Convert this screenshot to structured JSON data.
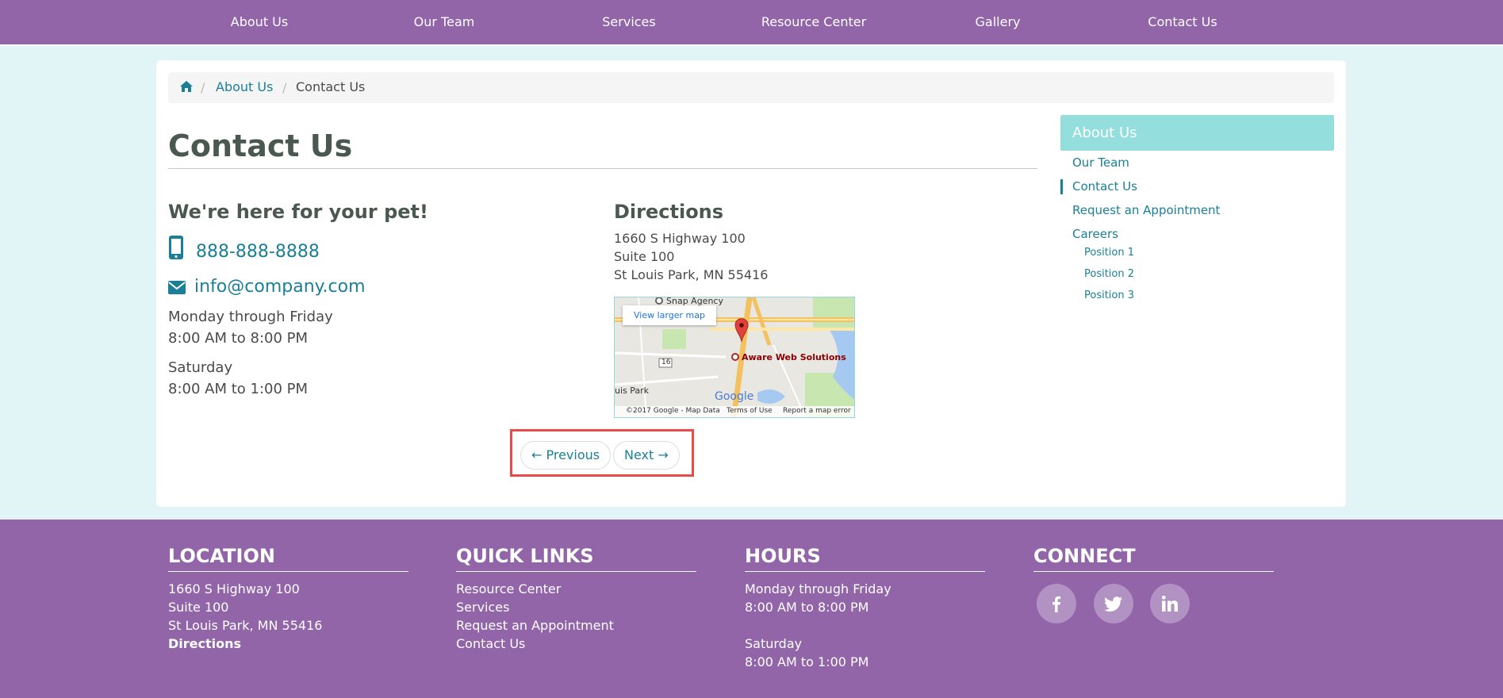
{
  "nav": {
    "items": [
      {
        "label": "About Us"
      },
      {
        "label": "Our Team"
      },
      {
        "label": "Services"
      },
      {
        "label": "Resource Center"
      },
      {
        "label": "Gallery"
      },
      {
        "label": "Contact Us"
      }
    ]
  },
  "breadcrumb": {
    "home_icon": "home-icon",
    "separator": "/",
    "items": [
      {
        "label": "About Us"
      },
      {
        "label": "Contact Us"
      }
    ]
  },
  "page": {
    "title": "Contact Us",
    "tagline": "We're here for your pet!",
    "phone": "888-888-8888",
    "email": "info@company.com",
    "hours": [
      "Monday through Friday",
      "8:00 AM to 8:00 PM",
      "Saturday",
      "8:00 AM to 1:00 PM"
    ]
  },
  "directions": {
    "title": "Directions",
    "address": [
      "1660 S Highway 100",
      "Suite 100",
      "St Louis Park, MN 55416"
    ]
  },
  "map": {
    "view_larger": "View larger map",
    "marker_label": "Aware Web Solutions",
    "places": [
      "Snap Agency",
      "uis Park",
      "16"
    ],
    "logo": "Google",
    "footer": [
      "©2017 Google - Map Data",
      "Terms of Use",
      "Report a map error"
    ]
  },
  "pager": {
    "previous": "← Previous",
    "next": "Next →"
  },
  "sidebar": {
    "header": "About Us",
    "items": [
      {
        "label": "Our Team"
      },
      {
        "label": "Contact Us"
      },
      {
        "label": "Request an Appointment"
      },
      {
        "label": "Careers"
      }
    ],
    "sub_items": [
      {
        "label": "Position 1"
      },
      {
        "label": "Position 2"
      },
      {
        "label": "Position 3"
      }
    ]
  },
  "footer": {
    "location": {
      "heading": "LOCATION",
      "lines": [
        "1660 S Highway 100",
        "Suite 100",
        "St Louis Park, MN 55416"
      ],
      "link": "Directions"
    },
    "quick_links": {
      "heading": "QUICK LINKS",
      "links": [
        "Resource Center",
        "Services",
        "Request an Appointment",
        "Contact Us"
      ]
    },
    "hours": {
      "heading": "HOURS",
      "lines": [
        "Monday through Friday",
        "8:00 AM to 8:00 PM",
        "Saturday",
        "8:00 AM to 1:00 PM"
      ]
    },
    "connect": {
      "heading": "CONNECT",
      "icons": [
        "facebook-icon",
        "twitter-icon",
        "linkedin-icon"
      ]
    }
  },
  "colors": {
    "brand_purple": "#9264a8",
    "accent_teal": "#1a7f97",
    "sidebar_header": "#94dede",
    "page_bg": "#e2f5f6",
    "highlight_red": "#e94a4a"
  }
}
